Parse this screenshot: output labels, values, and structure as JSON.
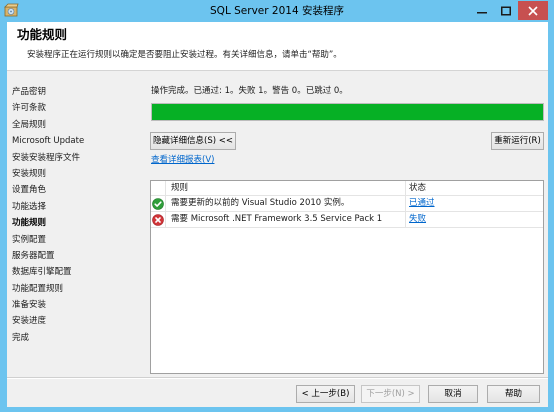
{
  "window": {
    "title": "SQL Server 2014 安装程序",
    "app_icon": "sql-setup-icon",
    "controls": {
      "minimize_icon": "minimize-icon",
      "maximize_icon": "maximize-icon",
      "close_icon": "close-icon"
    }
  },
  "colors": {
    "frame": "#6cc4ef",
    "close_button": "#c75050",
    "progress_fill": "#06b025",
    "link": "#0066cc",
    "passed": "#2f9e3a",
    "failed": "#d13438"
  },
  "header": {
    "title": "功能规则",
    "description": "安装程序正在运行规则以确定是否要阻止安装过程。有关详细信息，请单击“帮助”。"
  },
  "sidebar": {
    "items": [
      {
        "label": "产品密钥"
      },
      {
        "label": "许可条款"
      },
      {
        "label": "全局规则"
      },
      {
        "label": "Microsoft Update"
      },
      {
        "label": "安装安装程序文件"
      },
      {
        "label": "安装规则"
      },
      {
        "label": "设置角色"
      },
      {
        "label": "功能选择"
      },
      {
        "label": "功能规则",
        "active": true
      },
      {
        "label": "实例配置"
      },
      {
        "label": "服务器配置"
      },
      {
        "label": "数据库引擎配置"
      },
      {
        "label": "功能配置规则"
      },
      {
        "label": "准备安装"
      },
      {
        "label": "安装进度"
      },
      {
        "label": "完成"
      }
    ]
  },
  "main": {
    "status_text": "操作完成。已通过: 1。失败 1。警告 0。已跳过 0。",
    "progress": 1.0,
    "hide_details_button": "隐藏详细信息(S) <<",
    "rerun_button": "重新运行(R)",
    "report_link": "查看详细报表(V)",
    "rules_table": {
      "rule_header": "规则",
      "status_header": "状态",
      "rows": [
        {
          "status_icon": "passed-check-icon",
          "rule": "需要更新的以前的 Visual Studio 2010 实例。",
          "status": "已通过"
        },
        {
          "status_icon": "failed-x-icon",
          "rule": "需要 Microsoft .NET Framework 3.5 Service Pack 1",
          "status": "失败"
        }
      ]
    }
  },
  "footer": {
    "back_button": "< 上一步(B)",
    "next_button": "下一步(N) >",
    "next_enabled": false,
    "cancel_button": "取消",
    "help_button": "帮助"
  }
}
